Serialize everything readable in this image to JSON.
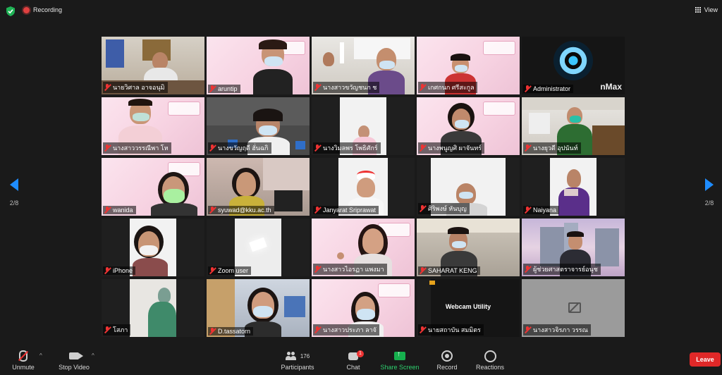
{
  "topbar": {
    "recording_label": "Recording",
    "view_label": "View"
  },
  "pager": {
    "left": "2/8",
    "right": "2/8"
  },
  "tiles": [
    {
      "name": "นายวิศาล อาจอนุมิ"
    },
    {
      "name": "aruntip"
    },
    {
      "name": "นางสาวขวัญชนก ช"
    },
    {
      "name": "เกศกนก ศรีสะกูล"
    },
    {
      "name": "Administrator"
    },
    {
      "name": "นางสาววรรณีพา โห"
    },
    {
      "name": "นางขวัญฤดี ฮั่นฉกิ"
    },
    {
      "name": "นางวิมลพร โพธิศักร์"
    },
    {
      "name": "นางพนูญศิ ผาจันทร์"
    },
    {
      "name": "นางยุวดี อุปนันท์"
    },
    {
      "name": "wanida"
    },
    {
      "name": "syuwad@kku.ac.th"
    },
    {
      "name": "Janyarat Sriprawat"
    },
    {
      "name": "ศิริพงษ์ หันบุญ"
    },
    {
      "name": "Naiyana"
    },
    {
      "name": "iPhone"
    },
    {
      "name": "Zoom user"
    },
    {
      "name": "นางสาวไอรฏา แพงมา"
    },
    {
      "name": "SAHARAT KENG"
    },
    {
      "name": "ผู้ช่วยศาสตราจารย์อนุช"
    },
    {
      "name": "โสภา"
    },
    {
      "name": "D.tassatorn"
    },
    {
      "name": "นางสาวประภา ลาจั"
    },
    {
      "name": "นายสถาบัน สมมิตร"
    },
    {
      "name": "นางสาวจิรภา วรรณ"
    }
  ],
  "webcam_tile": {
    "text": "Webcam Utility"
  },
  "admin_tile": {
    "logo_text": "nMax"
  },
  "toolbar": {
    "unmute": "Unmute",
    "stop_video": "Stop Video",
    "participants": "Participants",
    "participants_count": "176",
    "chat": "Chat",
    "chat_badge": "1",
    "share_screen": "Share Screen",
    "record": "Record",
    "reactions": "Reactions",
    "leave": "Leave"
  },
  "colors": {
    "accent": "#1e8cff",
    "leave": "#e02828",
    "share": "#16b04e",
    "muted": "#e33333"
  }
}
